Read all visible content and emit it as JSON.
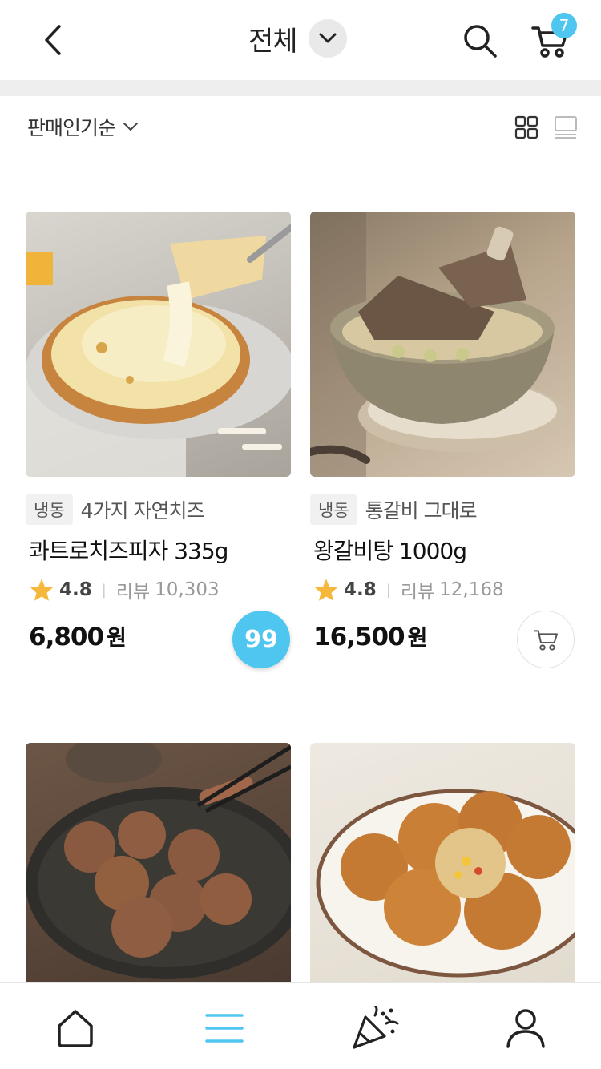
{
  "header": {
    "title": "전체",
    "cart_count": "7",
    "accent_color": "#4fc6ef"
  },
  "sort": {
    "label": "판매인기순"
  },
  "icons": [
    "back-icon",
    "chevron-down-icon",
    "search-icon",
    "cart-icon",
    "grid-view-icon",
    "list-view-icon",
    "star-icon",
    "home-icon",
    "menu-icon",
    "party-icon",
    "user-icon"
  ],
  "products": [
    {
      "tag": "냉동",
      "subtitle": "4가지 자연치즈",
      "name": "콰트로치즈피자 335g",
      "rating": "4.8",
      "review_label": "리뷰",
      "review_count": "10,303",
      "price": "6,800",
      "currency": "원",
      "badge": "99"
    },
    {
      "tag": "냉동",
      "subtitle": "통갈비 그대로",
      "name": "왕갈비탕 1000g",
      "rating": "4.8",
      "review_label": "리뷰",
      "review_count": "12,168",
      "price": "16,500",
      "currency": "원"
    },
    {},
    {}
  ]
}
